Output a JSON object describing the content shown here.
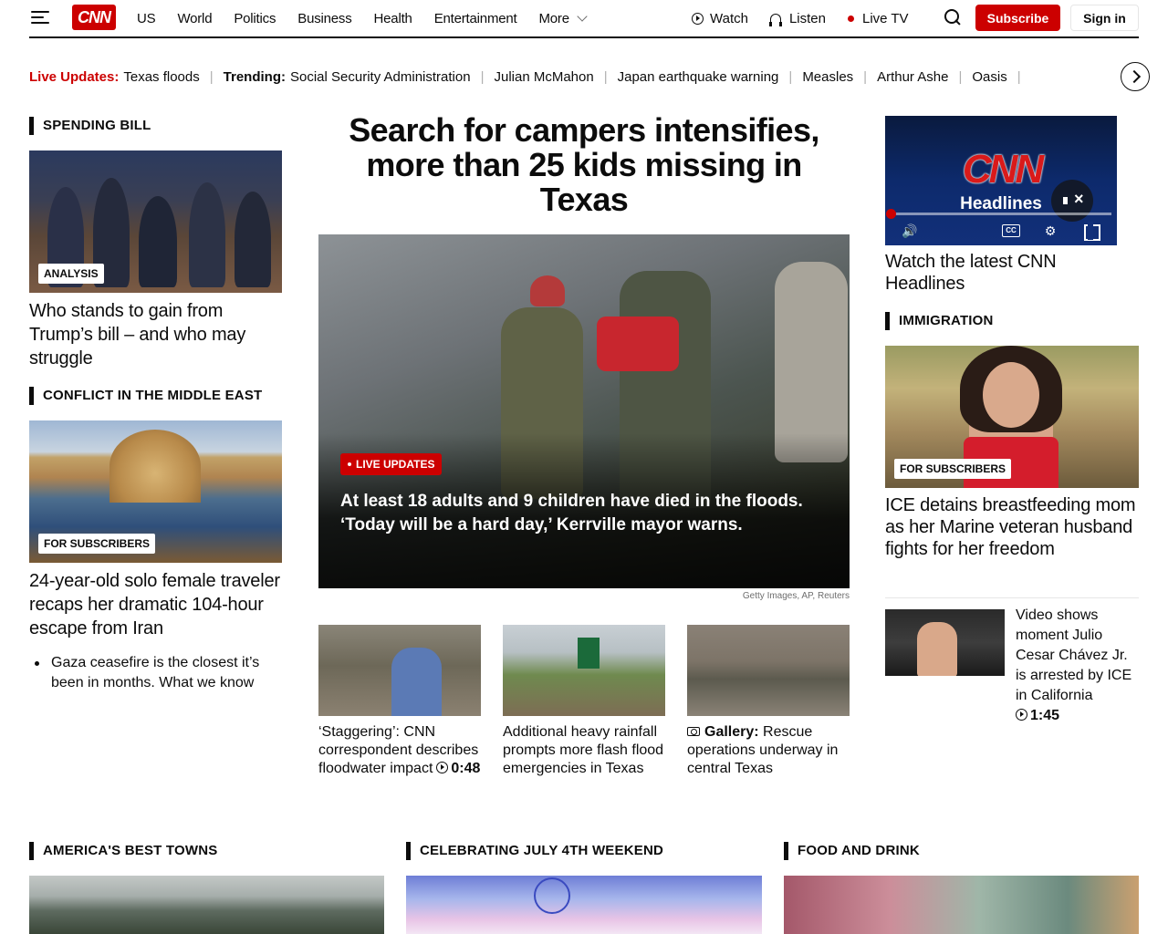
{
  "header": {
    "logo": "CNN",
    "nav": [
      "US",
      "World",
      "Politics",
      "Business",
      "Health",
      "Entertainment",
      "More"
    ],
    "watch": "Watch",
    "listen": "Listen",
    "live_tv": "Live TV",
    "subscribe": "Subscribe",
    "sign_in": "Sign in",
    "accent_color": "#cc0000"
  },
  "trending": {
    "live_label": "Live Updates:",
    "live_item": "Texas floods",
    "trending_label": "Trending:",
    "items": [
      "Social Security Administration",
      "Julian McMahon",
      "Japan earthquake warning",
      "Measles",
      "Arthur Ashe",
      "Oasis"
    ]
  },
  "left": {
    "section1": "SPENDING BILL",
    "s1_badge": "ANALYSIS",
    "s1_headline": "Who stands to gain from Trump’s bill – and who may struggle",
    "section2": "CONFLICT IN THE MIDDLE EAST",
    "s2_badge": "FOR SUBSCRIBERS",
    "s2_headline": "24-year-old solo female traveler recaps her dramatic 104-hour escape from Iran",
    "bullet": "Gaza ceasefire is the closest it’s been in months. What we know"
  },
  "center": {
    "title": "Search for campers intensifies, more than 25 kids missing in Texas",
    "live_badge": "LIVE UPDATES",
    "caption": "At least 18 adults and 9 children have died in the floods. ‘Today will be a hard day,’ Kerrville mayor warns.",
    "credit": "Getty Images, AP, Reuters",
    "cards": [
      {
        "text": "‘Staggering’: CNN correspondent describes floodwater impact",
        "duration": "0:48"
      },
      {
        "text": "Additional heavy rainfall prompts more flash flood emergencies in Texas"
      },
      {
        "label": "Gallery:",
        "text": "Rescue operations underway in central Texas"
      }
    ]
  },
  "right": {
    "video": {
      "logo": "CNN",
      "subtitle": "Headlines",
      "cc": "CC",
      "progress": 0.02
    },
    "video_title": "Watch the latest CNN Headlines",
    "section": "IMMIGRATION",
    "badge": "FOR SUBSCRIBERS",
    "headline": "ICE detains breastfeeding mom as her Marine veteran husband fights for her freedom",
    "small_story": "Video shows moment Julio Cesar Chávez Jr. is arrested by ICE in California",
    "small_duration": "1:45"
  },
  "bottom": {
    "sections": [
      "AMERICA'S BEST TOWNS",
      "CELEBRATING JULY 4TH WEEKEND",
      "FOOD AND DRINK"
    ]
  }
}
